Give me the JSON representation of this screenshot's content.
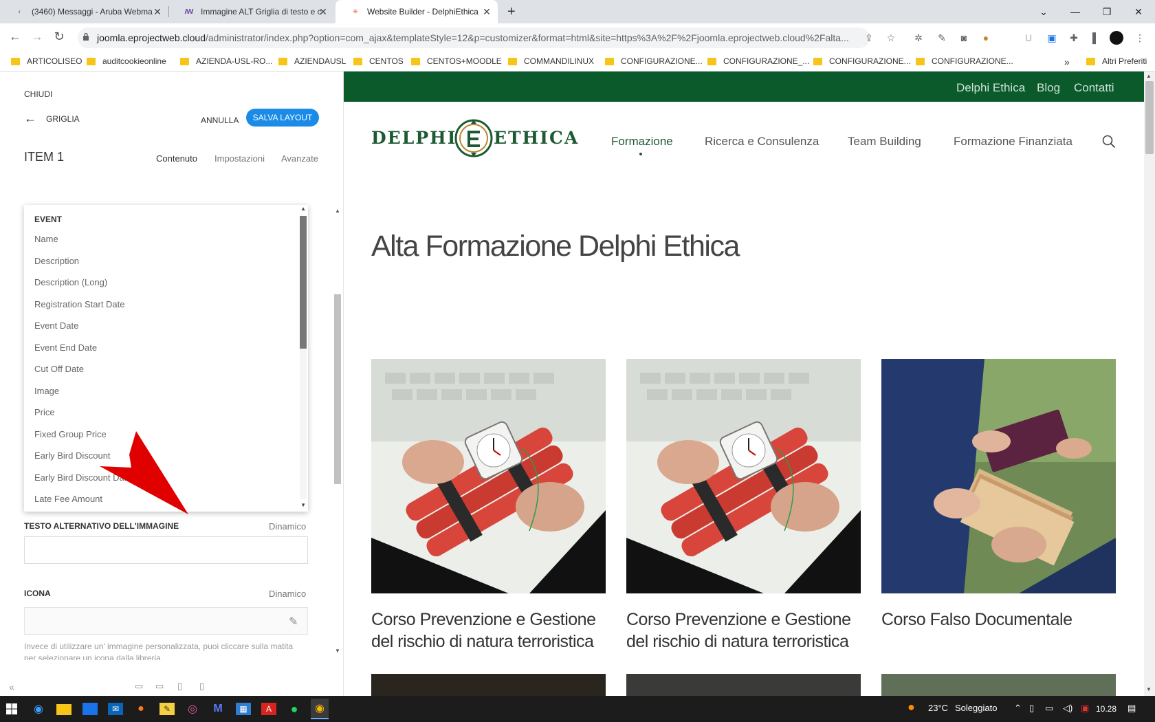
{
  "browser": {
    "tabs": [
      {
        "title": "(3460) Messaggi - Aruba Webma"
      },
      {
        "title": "Immagine ALT Griglia di testo e c"
      },
      {
        "title": "Website Builder - DelphiEthica"
      }
    ],
    "url_domain": "joomla.eprojectweb.cloud",
    "url_path": "/administrator/index.php?option=com_ajax&templateStyle=12&p=customizer&format=html&site=https%3A%2F%2Fjoomla.eprojectweb.cloud%2Falta...",
    "bookmarks": [
      "ARTICOLISEO",
      "auditcookieonline",
      "AZIENDA-USL-RO...",
      "AZIENDAUSL",
      "CENTOS",
      "CENTOS+MOODLE",
      "COMMANDILINUX",
      "CONFIGURAZIONE...",
      "CONFIGURAZIONE_...",
      "CONFIGURAZIONE...",
      "CONFIGURAZIONE..."
    ],
    "more_bookmarks": "»",
    "other_bookmarks": "Altri Preferiti"
  },
  "panel": {
    "close_label": "CHIUDI",
    "section_title": "GRIGLIA",
    "cancel_label": "ANNULLA",
    "save_label": "SALVA LAYOUT",
    "item_title": "ITEM 1",
    "tabs": [
      "Contenuto",
      "Impostazioni",
      "Avanzate"
    ],
    "dropdown": {
      "group": "EVENT",
      "options": [
        "Name",
        "Description",
        "Description (Long)",
        "Registration Start Date",
        "Event Date",
        "Event End Date",
        "Cut Off Date",
        "Image",
        "Price",
        "Fixed Group Price",
        "Early Bird Discount",
        "Early Bird Discount Date",
        "Late Fee Amount"
      ]
    },
    "alt_label": "TESTO ALTERNATIVO DELL'IMMAGINE",
    "alt_dynamic": "Dinamico",
    "alt_value": "",
    "icon_label": "ICONA",
    "icon_dynamic": "Dinamico",
    "icon_help": "Invece di utilizzare un' immagine personalizzata, puoi cliccare sulla matita per selezionare un icona dalla libreria.",
    "collapse": "«"
  },
  "site": {
    "top_links": [
      "Delphi Ethica",
      "Blog",
      "Contatti"
    ],
    "logo_left": "DELPHI",
    "logo_right": "ETHICA",
    "nav": [
      "Formazione",
      "Ricerca e Consulenza",
      "Team Building",
      "Formazione Finanziata"
    ],
    "heading": "Alta Formazione Delphi Ethica",
    "cards": [
      {
        "title": "Corso Prevenzione e Gestione del rischio di natura terroristica"
      },
      {
        "title": "Corso Prevenzione e Gestione del rischio di natura terroristica"
      },
      {
        "title": "Corso Falso Documentale"
      }
    ]
  },
  "taskbar": {
    "weather": "23°C",
    "weather_text": "Soleggiato",
    "time": "10.28"
  },
  "colors": {
    "brand_green": "#0a5a2c",
    "accent_blue": "#1a8ce8",
    "arrow_red": "#e00000"
  }
}
